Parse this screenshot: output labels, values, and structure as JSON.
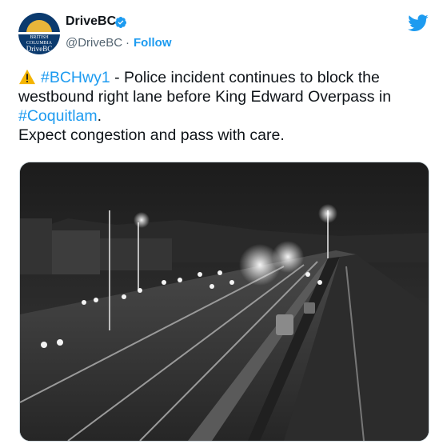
{
  "tweet": {
    "display_name": "DriveBC",
    "handle": "@DriveBC",
    "separator": "·",
    "follow_label": "Follow",
    "avatar_caption": "BRITISH COLUMBIA",
    "avatar_logo": "DriveBC",
    "hashtag_highway": "#BCHwy1",
    "text_part1": " - Police incident continues to block the westbound right lane before King Edward Overpass in ",
    "hashtag_city": "#Coquitlam",
    "text_part2": ".",
    "text_line2": "Expect congestion and pass with care.",
    "accent_color": "#1d9bf0"
  },
  "media": {
    "icon": "highway-camera-image"
  }
}
